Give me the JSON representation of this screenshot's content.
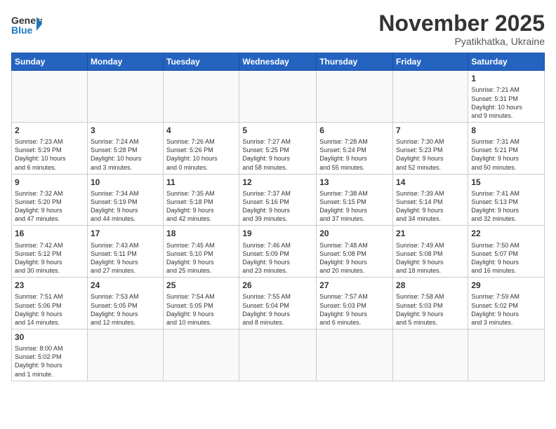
{
  "header": {
    "logo_general": "General",
    "logo_blue": "Blue",
    "month": "November 2025",
    "location": "Pyatikhatka, Ukraine"
  },
  "days_of_week": [
    "Sunday",
    "Monday",
    "Tuesday",
    "Wednesday",
    "Thursday",
    "Friday",
    "Saturday"
  ],
  "weeks": [
    [
      {
        "day": "",
        "info": ""
      },
      {
        "day": "",
        "info": ""
      },
      {
        "day": "",
        "info": ""
      },
      {
        "day": "",
        "info": ""
      },
      {
        "day": "",
        "info": ""
      },
      {
        "day": "",
        "info": ""
      },
      {
        "day": "1",
        "info": "Sunrise: 7:21 AM\nSunset: 5:31 PM\nDaylight: 10 hours\nand 9 minutes."
      }
    ],
    [
      {
        "day": "2",
        "info": "Sunrise: 7:23 AM\nSunset: 5:29 PM\nDaylight: 10 hours\nand 6 minutes."
      },
      {
        "day": "3",
        "info": "Sunrise: 7:24 AM\nSunset: 5:28 PM\nDaylight: 10 hours\nand 3 minutes."
      },
      {
        "day": "4",
        "info": "Sunrise: 7:26 AM\nSunset: 5:26 PM\nDaylight: 10 hours\nand 0 minutes."
      },
      {
        "day": "5",
        "info": "Sunrise: 7:27 AM\nSunset: 5:25 PM\nDaylight: 9 hours\nand 58 minutes."
      },
      {
        "day": "6",
        "info": "Sunrise: 7:28 AM\nSunset: 5:24 PM\nDaylight: 9 hours\nand 55 minutes."
      },
      {
        "day": "7",
        "info": "Sunrise: 7:30 AM\nSunset: 5:23 PM\nDaylight: 9 hours\nand 52 minutes."
      },
      {
        "day": "8",
        "info": "Sunrise: 7:31 AM\nSunset: 5:21 PM\nDaylight: 9 hours\nand 50 minutes."
      }
    ],
    [
      {
        "day": "9",
        "info": "Sunrise: 7:32 AM\nSunset: 5:20 PM\nDaylight: 9 hours\nand 47 minutes."
      },
      {
        "day": "10",
        "info": "Sunrise: 7:34 AM\nSunset: 5:19 PM\nDaylight: 9 hours\nand 44 minutes."
      },
      {
        "day": "11",
        "info": "Sunrise: 7:35 AM\nSunset: 5:18 PM\nDaylight: 9 hours\nand 42 minutes."
      },
      {
        "day": "12",
        "info": "Sunrise: 7:37 AM\nSunset: 5:16 PM\nDaylight: 9 hours\nand 39 minutes."
      },
      {
        "day": "13",
        "info": "Sunrise: 7:38 AM\nSunset: 5:15 PM\nDaylight: 9 hours\nand 37 minutes."
      },
      {
        "day": "14",
        "info": "Sunrise: 7:39 AM\nSunset: 5:14 PM\nDaylight: 9 hours\nand 34 minutes."
      },
      {
        "day": "15",
        "info": "Sunrise: 7:41 AM\nSunset: 5:13 PM\nDaylight: 9 hours\nand 32 minutes."
      }
    ],
    [
      {
        "day": "16",
        "info": "Sunrise: 7:42 AM\nSunset: 5:12 PM\nDaylight: 9 hours\nand 30 minutes."
      },
      {
        "day": "17",
        "info": "Sunrise: 7:43 AM\nSunset: 5:11 PM\nDaylight: 9 hours\nand 27 minutes."
      },
      {
        "day": "18",
        "info": "Sunrise: 7:45 AM\nSunset: 5:10 PM\nDaylight: 9 hours\nand 25 minutes."
      },
      {
        "day": "19",
        "info": "Sunrise: 7:46 AM\nSunset: 5:09 PM\nDaylight: 9 hours\nand 23 minutes."
      },
      {
        "day": "20",
        "info": "Sunrise: 7:48 AM\nSunset: 5:08 PM\nDaylight: 9 hours\nand 20 minutes."
      },
      {
        "day": "21",
        "info": "Sunrise: 7:49 AM\nSunset: 5:08 PM\nDaylight: 9 hours\nand 18 minutes."
      },
      {
        "day": "22",
        "info": "Sunrise: 7:50 AM\nSunset: 5:07 PM\nDaylight: 9 hours\nand 16 minutes."
      }
    ],
    [
      {
        "day": "23",
        "info": "Sunrise: 7:51 AM\nSunset: 5:06 PM\nDaylight: 9 hours\nand 14 minutes."
      },
      {
        "day": "24",
        "info": "Sunrise: 7:53 AM\nSunset: 5:05 PM\nDaylight: 9 hours\nand 12 minutes."
      },
      {
        "day": "25",
        "info": "Sunrise: 7:54 AM\nSunset: 5:05 PM\nDaylight: 9 hours\nand 10 minutes."
      },
      {
        "day": "26",
        "info": "Sunrise: 7:55 AM\nSunset: 5:04 PM\nDaylight: 9 hours\nand 8 minutes."
      },
      {
        "day": "27",
        "info": "Sunrise: 7:57 AM\nSunset: 5:03 PM\nDaylight: 9 hours\nand 6 minutes."
      },
      {
        "day": "28",
        "info": "Sunrise: 7:58 AM\nSunset: 5:03 PM\nDaylight: 9 hours\nand 5 minutes."
      },
      {
        "day": "29",
        "info": "Sunrise: 7:59 AM\nSunset: 5:02 PM\nDaylight: 9 hours\nand 3 minutes."
      }
    ],
    [
      {
        "day": "30",
        "info": "Sunrise: 8:00 AM\nSunset: 5:02 PM\nDaylight: 9 hours\nand 1 minute."
      },
      {
        "day": "",
        "info": ""
      },
      {
        "day": "",
        "info": ""
      },
      {
        "day": "",
        "info": ""
      },
      {
        "day": "",
        "info": ""
      },
      {
        "day": "",
        "info": ""
      },
      {
        "day": "",
        "info": ""
      }
    ]
  ]
}
